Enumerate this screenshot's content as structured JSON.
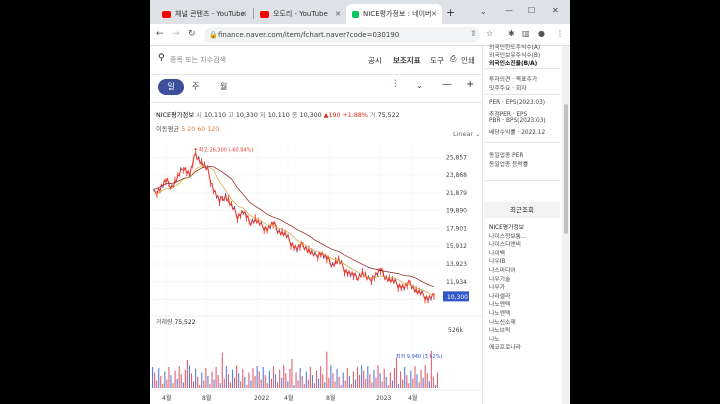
{
  "browser": {
    "tabs": [
      {
        "title": "채널 콘텐츠 - YouTube",
        "favicon_color": "#ff0000",
        "active": false
      },
      {
        "title": "오도리 - YouTube",
        "favicon_color": "#ff0000",
        "active": false
      },
      {
        "title": "NICE평가정보 : 네이버",
        "favicon_color": "#03c75a",
        "active": true
      }
    ],
    "new_tab_label": "+",
    "url": "finance.naver.com/item/fchart.naver?code=030190",
    "icons": [
      "back-icon",
      "forward-icon",
      "reload-icon",
      "lock-icon",
      "share-icon",
      "star-icon",
      "extensions-icon",
      "sidepanel-icon",
      "profile-icon",
      "menu-icon"
    ]
  },
  "search": {
    "placeholder": "종목 또는 지수검색"
  },
  "top_menu": {
    "notice": "공시",
    "indicator": "보조지표",
    "tools": "도구",
    "print": "인쇄"
  },
  "periods": [
    "일",
    "주",
    "월"
  ],
  "stock": {
    "name": "NICE평가정보",
    "open_label": "시",
    "open": "10,110",
    "high_label": "고",
    "high": "10,330",
    "low_label": "저",
    "low": "10,110",
    "close_label": "종",
    "close": "10,300",
    "change": "▲190",
    "change_pct": "+1.88%",
    "volume_label": "거",
    "volume": "75,522"
  },
  "ma": {
    "label": "이동평균",
    "periods": "5 20 60 120"
  },
  "scale_mode": "Linear",
  "volume_panel": {
    "label": "거래량",
    "value": "75,522",
    "axis_label": "526k"
  },
  "chart_data": {
    "type": "line",
    "y_ticks": [
      "25,857",
      "23,868",
      "21,879",
      "19,890",
      "17,901",
      "15,912",
      "13,923",
      "11,934",
      "9,945"
    ],
    "ylim": [
      9000,
      27800
    ],
    "x_ticks": [
      "4월",
      "8월",
      "2022",
      "4월",
      "8월",
      "2023",
      "4월"
    ],
    "max_annotation": "최고 26,300 (-60.84%)",
    "min_annotation": "최저 9,940 (3.62%)",
    "current_value": "10,300",
    "series": [
      {
        "values": [
          21800,
          22400,
          23200,
          22600,
          23600,
          24800,
          23900,
          26300,
          25200,
          24400,
          22300,
          20900,
          21600,
          20400,
          19300,
          19800,
          18600,
          18900,
          18200,
          17900,
          18400,
          17600,
          17200,
          16300,
          15600,
          16100,
          15400,
          14800,
          15200,
          14500,
          13900,
          14300,
          13300,
          12800,
          12400,
          12900,
          12100,
          12600,
          13200,
          12400,
          12000,
          11600,
          11300,
          11800,
          10900,
          10500,
          10100,
          10300
        ],
        "color": "#e83a30"
      }
    ],
    "ma_color": "#8b1a1a",
    "ma2_color": "#d7a52a",
    "volume_color": "#e06070"
  },
  "side_panel": {
    "items_top": [
      "외국인한도주식수(A)",
      "외국인보유주식수(B)",
      "외국인소진율(B/A)"
    ],
    "items_mid": [
      "투자의견 · 목표주가",
      "밋주주요 · 회자"
    ],
    "items_eps": [
      "PER · EPS(2023.03)",
      "추정PER · EPS",
      "PBR · BPS(2023.03)",
      "배당수익률 · 2022.12"
    ],
    "items_sector": [
      "동일업종 PER",
      "동일업종 등락률"
    ],
    "recent_header": "최근조회",
    "recent": [
      "NICE평가정보",
      "나이스정보통...",
      "나이스디앤비",
      "나이벡",
      "나우IB",
      "나스미디어",
      "나우기술",
      "나무가",
      "나라셀라",
      "나노엔텍",
      "나노엔텍",
      "나노신소재",
      "나노브릭",
      "나노",
      "에코프로나라"
    ]
  }
}
